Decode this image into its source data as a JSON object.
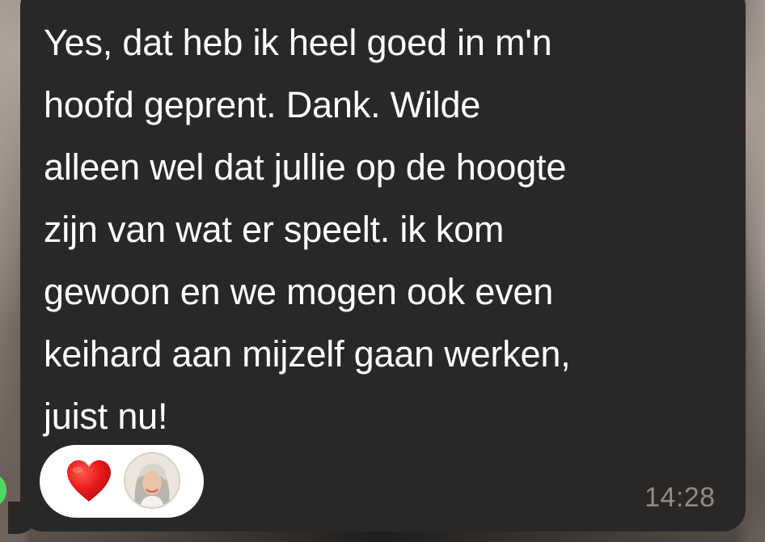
{
  "message": {
    "text": "Yes, dat heb ik heel goed in m'n\nhoofd geprent. Dank. Wilde\nalleen wel dat jullie op de hoogte\nzijn van wat er speelt. ik kom\ngewoon en we mogen ook even\nkeihard aan mijzelf gaan werken,\njuist nu!",
    "timestamp": "14:28"
  },
  "reactions": {
    "emoji_icon": "red-heart-icon",
    "avatar": "user-avatar"
  },
  "colors": {
    "bubble": "#2a2827",
    "text": "#ffffff",
    "timestamp": "#8e8b88",
    "heart": "#e8191a",
    "reaction_pill": "#ffffff",
    "online_indicator": "#4cd964"
  }
}
